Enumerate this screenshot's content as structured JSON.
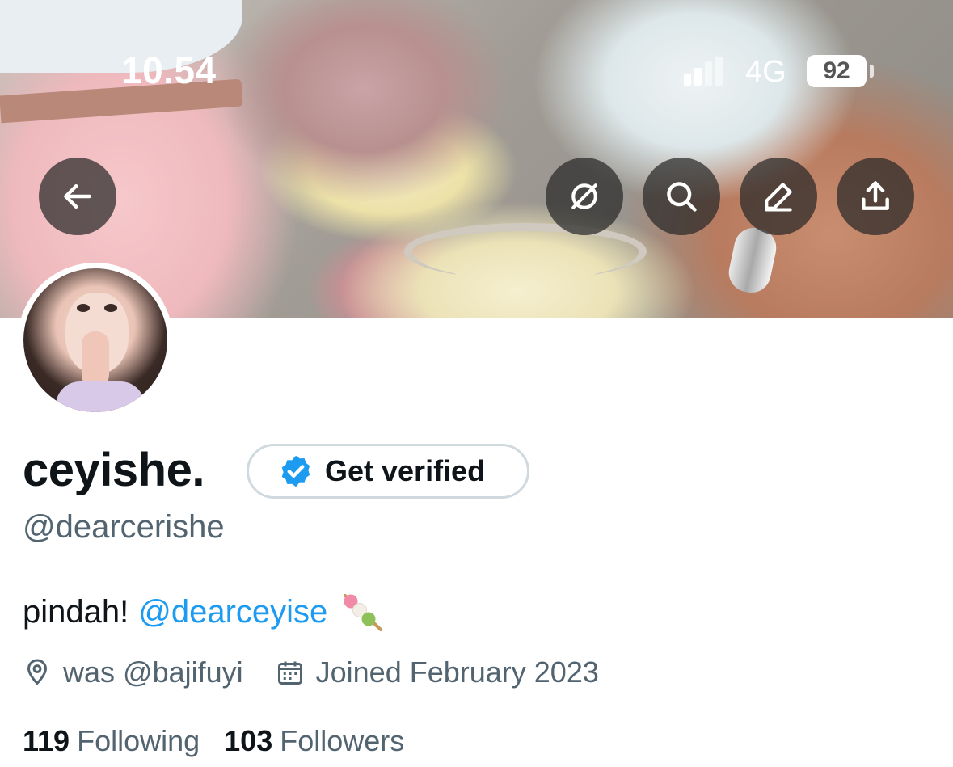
{
  "status_bar": {
    "time": "10.54",
    "network": "4G",
    "battery": "92"
  },
  "banner": {
    "actions": {
      "back": "arrow-left-icon",
      "grok": "slash-circle-icon",
      "search": "search-icon",
      "edit": "pencil-icon",
      "share": "share-icon"
    }
  },
  "profile": {
    "display_name": "ceyishe.",
    "verify_label": "Get verified",
    "handle": "@dearcerishe",
    "bio": {
      "text": "pindah!",
      "mention": "@dearceyise"
    },
    "location": "was @bajifuyi",
    "joined": "Joined February 2023",
    "following_count": "119",
    "following_label": "Following",
    "followers_count": "103",
    "followers_label": "Followers"
  },
  "colors": {
    "link": "#1d9bf0",
    "secondary_text": "#536471",
    "primary_text": "#0f1419"
  }
}
